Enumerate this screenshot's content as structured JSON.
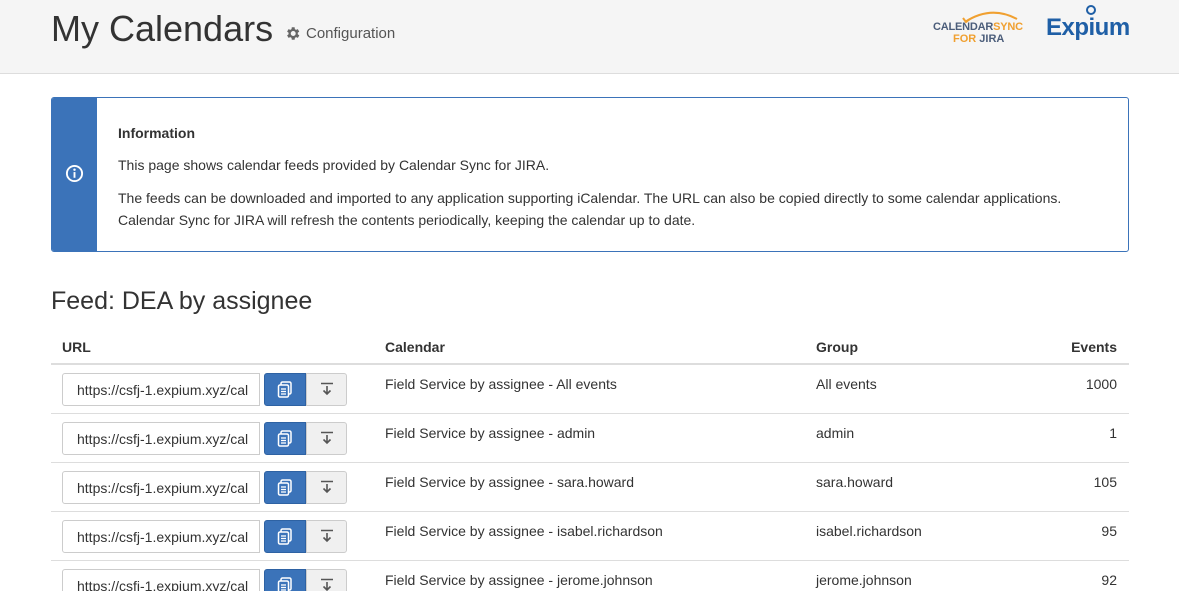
{
  "header": {
    "title": "My Calendars",
    "config_label": "Configuration",
    "logo_calendarsync": {
      "line1_a": "CALENDAR",
      "line1_b": "SYNC",
      "line2_a": "FOR ",
      "line2_b": "JIRA"
    },
    "logo_expium": "Expium"
  },
  "info": {
    "title": "Information",
    "p1": "This page shows calendar feeds provided by Calendar Sync for JIRA.",
    "p2": "The feeds can be downloaded and imported to any application supporting iCalendar. The URL can also be copied directly to some calendar applications. Calendar Sync for JIRA will refresh the contents periodically, keeping the calendar up to date."
  },
  "feed": {
    "title": "Feed: DEA by assignee",
    "columns": {
      "url": "URL",
      "calendar": "Calendar",
      "group": "Group",
      "events": "Events"
    },
    "rows": [
      {
        "url": "https://csfj-1.expium.xyz/cal",
        "calendar": "Field Service by assignee - All events",
        "group": "All events",
        "events": "1000"
      },
      {
        "url": "https://csfj-1.expium.xyz/cal",
        "calendar": "Field Service by assignee - admin",
        "group": "admin",
        "events": "1"
      },
      {
        "url": "https://csfj-1.expium.xyz/cal",
        "calendar": "Field Service by assignee - sara.howard",
        "group": "sara.howard",
        "events": "105"
      },
      {
        "url": "https://csfj-1.expium.xyz/cal",
        "calendar": "Field Service by assignee - isabel.richardson",
        "group": "isabel.richardson",
        "events": "95"
      },
      {
        "url": "https://csfj-1.expium.xyz/cal",
        "calendar": "Field Service by assignee - jerome.johnson",
        "group": "jerome.johnson",
        "events": "92"
      }
    ]
  },
  "icons": {
    "config": "gear-icon",
    "info": "info-circle-icon",
    "copy": "copy-icon",
    "download": "download-icon"
  },
  "colors": {
    "accent": "#3b73b9",
    "header_bg": "#f5f5f5",
    "logo_orange": "#f0a030",
    "logo_blue": "#1f5fa6"
  }
}
